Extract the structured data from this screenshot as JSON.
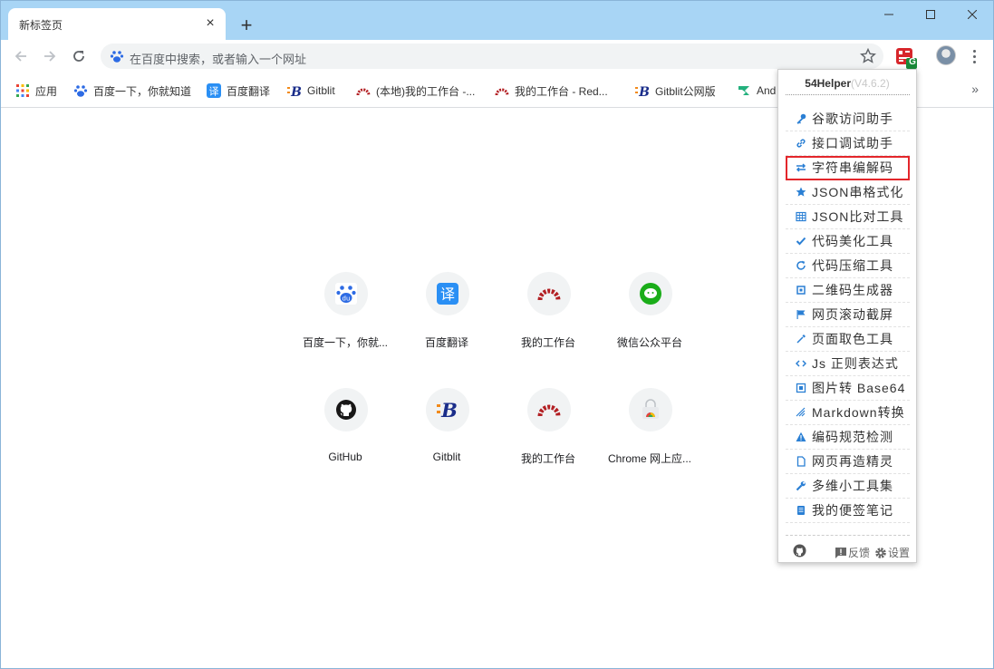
{
  "tab": {
    "title": "新标签页",
    "close": "×"
  },
  "new_tab_label": "+",
  "omnibox": {
    "placeholder": "在百度中搜索，或者输入一个网址"
  },
  "bookmarks": [
    {
      "label": "应用",
      "icon": "apps-grid-icon"
    },
    {
      "label": "百度一下，你就知道",
      "icon": "baidu-paw-icon"
    },
    {
      "label": "百度翻译",
      "icon": "baidu-translate-icon"
    },
    {
      "label": "Gitblit",
      "icon": "gitblit-icon"
    },
    {
      "label": "(本地)我的工作台 -...",
      "icon": "redmine-icon"
    },
    {
      "label": "我的工作台 - Red...",
      "icon": "redmine-icon"
    },
    {
      "label": "Gitblit公网版",
      "icon": "gitblit-icon"
    },
    {
      "label": "And",
      "icon": "android-icon"
    }
  ],
  "bookmarks_more": "»",
  "tiles": [
    {
      "label": "百度一下，你就...",
      "icon": "baidu-paw-icon"
    },
    {
      "label": "百度翻译",
      "icon": "baidu-translate-icon"
    },
    {
      "label": "我的工作台",
      "icon": "redmine-icon"
    },
    {
      "label": "微信公众平台",
      "icon": "wechat-icon"
    },
    {
      "label": "GitHub",
      "icon": "github-icon"
    },
    {
      "label": "Gitblit",
      "icon": "gitblit-icon"
    },
    {
      "label": "我的工作台",
      "icon": "redmine-icon"
    },
    {
      "label": "Chrome 网上应...",
      "icon": "chrome-webstore-icon"
    }
  ],
  "extension_badge": "G",
  "popup": {
    "title": "54Helper",
    "version": "(V4.6.2)",
    "items": [
      {
        "label": "谷歌访问助手",
        "icon": "key-icon"
      },
      {
        "label": "接口调试助手",
        "icon": "link-icon"
      },
      {
        "label": "字符串编解码",
        "icon": "exchange-icon",
        "selected": true
      },
      {
        "label": "JSON串格式化",
        "icon": "star-icon"
      },
      {
        "label": "JSON比对工具",
        "icon": "grid-icon"
      },
      {
        "label": "代码美化工具",
        "icon": "check-icon"
      },
      {
        "label": "代码压缩工具",
        "icon": "refresh-icon"
      },
      {
        "label": "二维码生成器",
        "icon": "qrcode-icon"
      },
      {
        "label": "网页滚动截屏",
        "icon": "flag-icon"
      },
      {
        "label": "页面取色工具",
        "icon": "eyedropper-icon"
      },
      {
        "label": "Js 正则表达式",
        "icon": "code-icon"
      },
      {
        "label": "图片转 Base64",
        "icon": "picture-icon"
      },
      {
        "label": "Markdown转换",
        "icon": "markdown-icon"
      },
      {
        "label": "编码规范检测",
        "icon": "warning-icon"
      },
      {
        "label": "网页再造精灵",
        "icon": "file-icon"
      },
      {
        "label": "多维小工具集",
        "icon": "wrench-icon"
      },
      {
        "label": "我的便签笔记",
        "icon": "notebook-icon"
      }
    ],
    "feedback": "反馈",
    "settings": "设置"
  },
  "colors": {
    "titlebar": "#a8d5f5",
    "accent_blue": "#1a73e8",
    "selected_outline": "#e3262b",
    "redmine": "#b32024"
  }
}
